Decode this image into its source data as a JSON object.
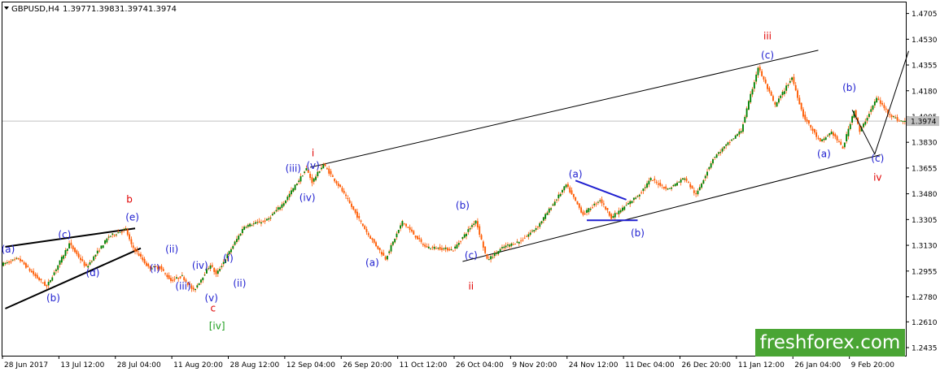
{
  "header": {
    "symbol": "GBPUSD,H4",
    "open": "1.3977",
    "high": "1.3983",
    "low": "1.3974",
    "close": "1.3974",
    "menu_icon": "triangle-down-icon"
  },
  "watermark": "freshforex.com",
  "colors": {
    "candle": "#008000",
    "candle_outline": "#ff5a00",
    "wave_blue": "#2020d0",
    "wave_red": "#e00000",
    "wave_green": "#1e9e1e",
    "channel": "#000000",
    "price_line": "#c0c0c0",
    "price_label_bg": "#c0c0c0"
  },
  "chart_data": {
    "type": "candlestick",
    "title": "GBPUSD,H4",
    "ylim": [
      1.238,
      1.478
    ],
    "yticks": [
      "1.4705",
      "1.4530",
      "1.4355",
      "1.4180",
      "1.4005",
      "1.3830",
      "1.3655",
      "1.3480",
      "1.3305",
      "1.3130",
      "1.2955",
      "1.2780",
      "1.2610",
      "1.2435"
    ],
    "current_price": "1.3974",
    "current_price_value": 1.3974,
    "xlabels": [
      "28 Jun 2017",
      "13 Jul 12:00",
      "28 Jul 04:00",
      "11 Aug 20:00",
      "28 Aug 12:00",
      "12 Sep 04:00",
      "26 Sep 20:00",
      "11 Oct 12:00",
      "26 Oct 04:00",
      "9 Nov 20:00",
      "24 Nov 12:00",
      "11 Dec 04:00",
      "26 Dec 20:00",
      "11 Jan 12:00",
      "26 Jan 04:00",
      "9 Feb 20:00"
    ],
    "bars_total": 160,
    "bars_per_label": 10,
    "pivots": [
      [
        0,
        1.3
      ],
      [
        3,
        1.304
      ],
      [
        6,
        1.292
      ],
      [
        8,
        1.285
      ],
      [
        12,
        1.314
      ],
      [
        15,
        1.298
      ],
      [
        19,
        1.319
      ],
      [
        22,
        1.324
      ],
      [
        23,
        1.313
      ],
      [
        26,
        1.298
      ],
      [
        28,
        1.298
      ],
      [
        30,
        1.289
      ],
      [
        32,
        1.292
      ],
      [
        34,
        1.282
      ],
      [
        37,
        1.3
      ],
      [
        38,
        1.293
      ],
      [
        43,
        1.326
      ],
      [
        47,
        1.33
      ],
      [
        50,
        1.342
      ],
      [
        54,
        1.365
      ],
      [
        55,
        1.356
      ],
      [
        57,
        1.368
      ],
      [
        60,
        1.352
      ],
      [
        65,
        1.32
      ],
      [
        68,
        1.304
      ],
      [
        71,
        1.329
      ],
      [
        75,
        1.312
      ],
      [
        80,
        1.31
      ],
      [
        84,
        1.33
      ],
      [
        86,
        1.303
      ],
      [
        89,
        1.312
      ],
      [
        92,
        1.316
      ],
      [
        95,
        1.326
      ],
      [
        100,
        1.354
      ],
      [
        103,
        1.334
      ],
      [
        106,
        1.344
      ],
      [
        108,
        1.332
      ],
      [
        110,
        1.338
      ],
      [
        113,
        1.348
      ],
      [
        115,
        1.358
      ],
      [
        118,
        1.351
      ],
      [
        121,
        1.359
      ],
      [
        123,
        1.347
      ],
      [
        126,
        1.372
      ],
      [
        131,
        1.391
      ],
      [
        134,
        1.434
      ],
      [
        137,
        1.408
      ],
      [
        140,
        1.427
      ],
      [
        142,
        1.401
      ],
      [
        145,
        1.383
      ],
      [
        147,
        1.39
      ],
      [
        149,
        1.379
      ],
      [
        151,
        1.405
      ],
      [
        152,
        1.39
      ],
      [
        155,
        1.413
      ],
      [
        157,
        1.403
      ],
      [
        159,
        1.3974
      ]
    ],
    "channels": [
      {
        "name": "upper-channel",
        "points": [
          [
            54,
            1.366
          ],
          [
            144,
            1.4455
          ]
        ]
      },
      {
        "name": "lower-channel",
        "points": [
          [
            81,
            1.302
          ],
          [
            155,
            1.3745
          ]
        ]
      },
      {
        "name": "wedge-upper",
        "points": [
          [
            0,
            1.312
          ],
          [
            23,
            1.3245
          ]
        ]
      },
      {
        "name": "wedge-lower",
        "points": [
          [
            0,
            1.27
          ],
          [
            24,
            1.311
          ]
        ]
      },
      {
        "name": "triangle-upper",
        "points": [
          [
            101,
            1.357
          ],
          [
            110,
            1.344
          ]
        ],
        "color": "blue"
      },
      {
        "name": "triangle-lower",
        "points": [
          [
            103,
            1.33
          ],
          [
            112,
            1.33
          ]
        ],
        "color": "blue"
      }
    ],
    "forecast": [
      [
        150,
        1.405
      ],
      [
        154,
        1.375
      ],
      [
        160,
        1.445
      ]
    ],
    "annotations": [
      {
        "text": "(a)",
        "at": [
          0.5,
          1.308
        ],
        "color": "blue"
      },
      {
        "text": "(b)",
        "at": [
          8.5,
          1.275
        ],
        "color": "blue"
      },
      {
        "text": "(c)",
        "at": [
          10.5,
          1.318
        ],
        "color": "blue"
      },
      {
        "text": "(d)",
        "at": [
          15.5,
          1.292
        ],
        "color": "blue"
      },
      {
        "text": "(e)",
        "at": [
          22.5,
          1.33
        ],
        "color": "blue"
      },
      {
        "text": "b",
        "at": [
          22,
          1.342
        ],
        "color": "red"
      },
      {
        "text": "(i)",
        "at": [
          26.5,
          1.295
        ],
        "color": "blue"
      },
      {
        "text": "(ii)",
        "at": [
          29.5,
          1.308
        ],
        "color": "blue"
      },
      {
        "text": "(iii)",
        "at": [
          31.5,
          1.283
        ],
        "color": "blue"
      },
      {
        "text": "(iv)",
        "at": [
          34.5,
          1.297
        ],
        "color": "blue"
      },
      {
        "text": "(v)",
        "at": [
          36.5,
          1.275
        ],
        "color": "blue"
      },
      {
        "text": "c",
        "at": [
          36.8,
          1.268
        ],
        "color": "red"
      },
      {
        "text": "[iv]",
        "at": [
          37.5,
          1.256
        ],
        "color": "green"
      },
      {
        "text": "(i)",
        "at": [
          39.5,
          1.302
        ],
        "color": "blue"
      },
      {
        "text": "(ii)",
        "at": [
          41.5,
          1.285
        ],
        "color": "blue"
      },
      {
        "text": "(iii)",
        "at": [
          51,
          1.363
        ],
        "color": "blue"
      },
      {
        "text": "(iv)",
        "at": [
          53.5,
          1.343
        ],
        "color": "blue"
      },
      {
        "text": "(v)",
        "at": [
          54.5,
          1.365
        ],
        "color": "blue"
      },
      {
        "text": "i",
        "at": [
          54.5,
          1.3735
        ],
        "color": "red"
      },
      {
        "text": "(a)",
        "at": [
          65,
          1.299
        ],
        "color": "blue"
      },
      {
        "text": "(b)",
        "at": [
          81,
          1.338
        ],
        "color": "blue"
      },
      {
        "text": "(c)",
        "at": [
          82.5,
          1.304
        ],
        "color": "blue"
      },
      {
        "text": "ii",
        "at": [
          82.5,
          1.283
        ],
        "color": "red"
      },
      {
        "text": "(a)",
        "at": [
          101,
          1.359
        ],
        "color": "blue"
      },
      {
        "text": "(b)",
        "at": [
          112,
          1.319
        ],
        "color": "blue"
      },
      {
        "text": "iii",
        "at": [
          135,
          1.453
        ],
        "color": "red"
      },
      {
        "text": "(c)",
        "at": [
          135,
          1.44
        ],
        "color": "blue"
      },
      {
        "text": "(a)",
        "at": [
          145,
          1.373
        ],
        "color": "blue"
      },
      {
        "text": "(b)",
        "at": [
          149.5,
          1.418
        ],
        "color": "blue"
      },
      {
        "text": "(c)",
        "at": [
          154.5,
          1.37
        ],
        "color": "blue"
      },
      {
        "text": "iv",
        "at": [
          154.5,
          1.357
        ],
        "color": "red"
      }
    ]
  }
}
